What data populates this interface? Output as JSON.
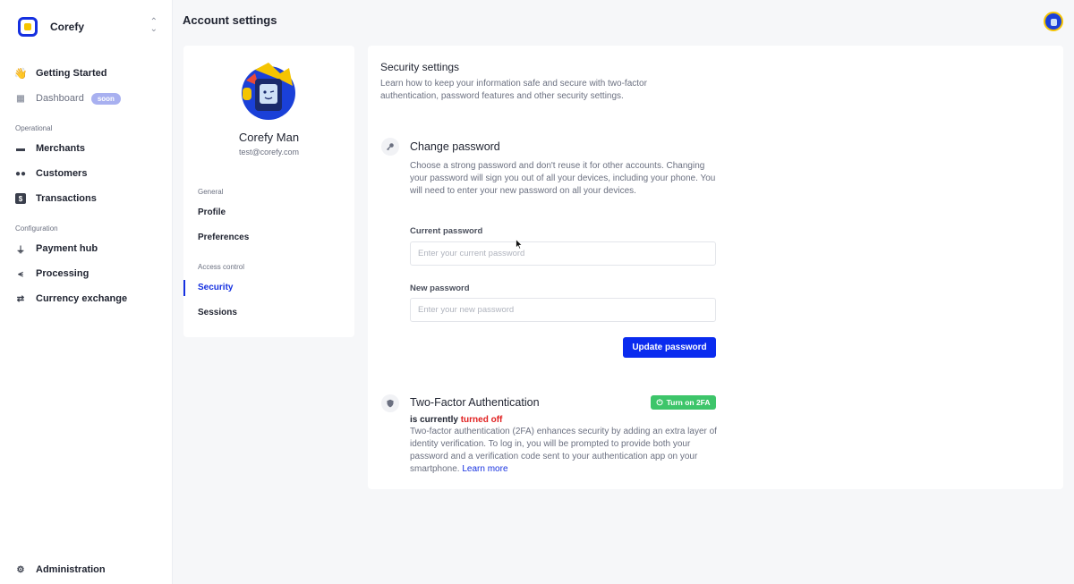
{
  "sidebar": {
    "brand": "Corefy",
    "items": [
      {
        "label": "Getting Started",
        "icon": "waving-hand-icon"
      },
      {
        "label": "Dashboard",
        "icon": "dashboard-icon",
        "badge": "soon"
      },
      {
        "label": "Merchants",
        "icon": "store-icon"
      },
      {
        "label": "Customers",
        "icon": "users-icon"
      },
      {
        "label": "Transactions",
        "icon": "dollar-icon"
      },
      {
        "label": "Payment hub",
        "icon": "plug-icon"
      },
      {
        "label": "Processing",
        "icon": "branch-icon"
      },
      {
        "label": "Currency exchange",
        "icon": "exchange-icon"
      },
      {
        "label": "Administration",
        "icon": "gear-icon"
      }
    ],
    "sections": {
      "operational": "Operational",
      "configuration": "Configuration"
    }
  },
  "header": {
    "title": "Account settings"
  },
  "profile": {
    "name": "Corefy Man",
    "email": "test@corefy.com",
    "sections": {
      "general": "General",
      "access": "Access control"
    },
    "nav": {
      "profile": "Profile",
      "preferences": "Preferences",
      "security": "Security",
      "sessions": "Sessions"
    }
  },
  "security": {
    "title": "Security settings",
    "description": "Learn how to keep your information safe and secure with two-factor authentication, password features and other security settings.",
    "password": {
      "title": "Change password",
      "description": "Choose a strong password and don't reuse it for other accounts. Changing your password will sign you out of all your devices, including your phone. You will need to enter your new password on all your devices.",
      "current_label": "Current password",
      "current_placeholder": "Enter your current password",
      "current_value": "",
      "new_label": "New password",
      "new_placeholder": "Enter your new password",
      "new_value": "",
      "button": "Update password"
    },
    "tfa": {
      "title": "Two-Factor Authentication",
      "status_prefix": "is currently",
      "status": "turned off",
      "button": "Turn on 2FA",
      "description": "Two-factor authentication (2FA) enhances security by adding an extra layer of identity verification. To log in, you will be prompted to provide both your password and a verification code sent to your authentication app on your smartphone.",
      "learn_more": "Learn more"
    }
  },
  "colors": {
    "accent": "#0a2bef",
    "success": "#3dc56a",
    "danger": "#e02020",
    "badge": "#a8b0f0"
  }
}
